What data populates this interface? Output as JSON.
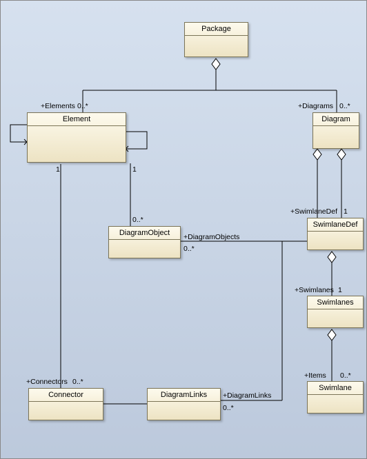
{
  "classes": {
    "package": "Package",
    "element": "Element",
    "diagram": "Diagram",
    "diagramObject": "DiagramObject",
    "swimlaneDef": "SwimlaneDef",
    "swimlanes": "Swimlanes",
    "swimlane": "Swimlane",
    "connector": "Connector",
    "diagramLinks": "DiagramLinks"
  },
  "labels": {
    "elementsRole": "+Elements",
    "elementsMult": "0..*",
    "diagramsRole": "+Diagrams",
    "diagramsMult": "0..*",
    "elem1a": "1",
    "elem1b": "1",
    "diagObjMult": "0..*",
    "diagObjRole": "+DiagramObjects",
    "diagObjMult2": "0..*",
    "swimlaneDefRole": "+SwimlaneDef",
    "swimlaneDefMult": "1",
    "swimlanesRole": "+Swimlanes",
    "swimlanesMult": "1",
    "itemsRole": "+Items",
    "itemsMult": "0..*",
    "connectorsRole": "+Connectors",
    "connectorsMult": "0..*",
    "diagLinksRole": "+DiagramLinks",
    "diagLinksMult": "0..*"
  },
  "chart_data": {
    "type": "uml_class_diagram",
    "classes": [
      "Package",
      "Element",
      "Diagram",
      "DiagramObject",
      "SwimlaneDef",
      "Swimlanes",
      "Swimlane",
      "Connector",
      "DiagramLinks"
    ],
    "relationships": [
      {
        "from": "Package",
        "to": "Element",
        "type": "aggregation",
        "role": "+Elements",
        "multiplicity": "0..*"
      },
      {
        "from": "Package",
        "to": "Diagram",
        "type": "aggregation",
        "role": "+Diagrams",
        "multiplicity": "0..*"
      },
      {
        "from": "Element",
        "to": "Element",
        "type": "self-association"
      },
      {
        "from": "Element",
        "to": "DiagramObject",
        "type": "association",
        "from_mult": "1",
        "to_mult": "0..*"
      },
      {
        "from": "Diagram",
        "to": "DiagramObject",
        "type": "aggregation",
        "role": "+DiagramObjects",
        "multiplicity": "0..*"
      },
      {
        "from": "Diagram",
        "to": "SwimlaneDef",
        "type": "aggregation",
        "role": "+SwimlaneDef",
        "multiplicity": "1"
      },
      {
        "from": "SwimlaneDef",
        "to": "Swimlanes",
        "type": "aggregation",
        "role": "+Swimlanes",
        "multiplicity": "1"
      },
      {
        "from": "Swimlanes",
        "to": "Swimlane",
        "type": "aggregation",
        "role": "+Items",
        "multiplicity": "0..*"
      },
      {
        "from": "Element",
        "to": "Connector",
        "type": "association",
        "from_mult": "1",
        "role": "+Connectors",
        "multiplicity": "0..*"
      },
      {
        "from": "Connector",
        "to": "DiagramLinks",
        "type": "association"
      },
      {
        "from": "Diagram",
        "to": "DiagramLinks",
        "type": "aggregation",
        "role": "+DiagramLinks",
        "multiplicity": "0..*"
      }
    ]
  }
}
